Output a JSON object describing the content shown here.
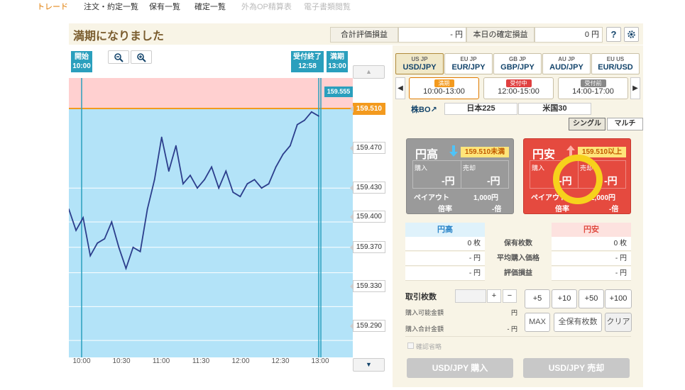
{
  "nav": {
    "items": [
      {
        "label": "トレード",
        "state": "active"
      },
      {
        "label": "注文・約定一覧",
        "state": "normal"
      },
      {
        "label": "保有一覧",
        "state": "normal"
      },
      {
        "label": "確定一覧",
        "state": "normal"
      },
      {
        "label": "外為OP精算表",
        "state": "disabled"
      },
      {
        "label": "電子書類閲覧",
        "state": "disabled"
      }
    ]
  },
  "status": {
    "title": "満期になりました"
  },
  "summary": {
    "valuation_label": "合計評価損益",
    "valuation_value": "- 円",
    "realized_label": "本日の確定損益",
    "realized_value": "0 円",
    "help_label": "?",
    "settings_icon": "gear-icon"
  },
  "chart": {
    "start_marker": {
      "label": "開始",
      "time": "10:00"
    },
    "close_marker": {
      "label": "受付終了",
      "time": "12:58"
    },
    "expiry_marker": {
      "label": "満期",
      "time": "13:00"
    },
    "current_price": "159.555",
    "target_price": "159.510",
    "price_labels": [
      "159.470",
      "159.430",
      "159.400",
      "159.370",
      "159.330",
      "159.290"
    ],
    "time_labels": [
      "10:00",
      "10:30",
      "11:00",
      "11:30",
      "12:00",
      "12:30",
      "13:00"
    ],
    "zoom_out_icon": "zoom-out-icon",
    "zoom_in_icon": "zoom-in-icon",
    "colors": {
      "upper_zone": "#ffd0d0",
      "lower_zone": "#b3e3f8",
      "line": "#2c3e8c",
      "target": "#f39a1e",
      "marker": "#2a9fbd"
    }
  },
  "chart_data": {
    "type": "line",
    "x": [
      "10:00",
      "10:05",
      "10:10",
      "10:15",
      "10:20",
      "10:25",
      "10:30",
      "10:35",
      "10:40",
      "10:45",
      "10:50",
      "10:55",
      "11:00",
      "11:05",
      "11:10",
      "11:15",
      "11:20",
      "11:25",
      "11:30",
      "11:35",
      "11:40",
      "11:45",
      "11:50",
      "11:55",
      "12:00",
      "12:05",
      "12:10",
      "12:15",
      "12:20",
      "12:25",
      "12:30",
      "12:35",
      "12:40",
      "12:45",
      "12:50",
      "12:55"
    ],
    "series": [
      {
        "values": [
          159.445,
          159.42,
          159.435,
          159.39,
          159.405,
          159.41,
          159.43,
          159.4,
          159.375,
          159.4,
          159.395,
          159.445,
          159.48,
          159.53,
          159.49,
          159.52,
          159.475,
          159.485,
          159.47,
          159.48,
          159.495,
          159.47,
          159.49,
          159.465,
          159.46,
          159.475,
          159.48,
          159.47,
          159.475,
          159.495,
          159.51,
          159.52,
          159.545,
          159.55,
          159.56,
          159.555
        ]
      }
    ],
    "xlabel": "",
    "ylabel": "",
    "ylim": [
      159.27,
      159.6
    ],
    "title": ""
  },
  "pairs": {
    "tabs": [
      {
        "label": "USD/JPY",
        "flags": "US JP",
        "selected": true
      },
      {
        "label": "EUR/JPY",
        "flags": "EU JP",
        "selected": false
      },
      {
        "label": "GBP/JPY",
        "flags": "GB JP",
        "selected": false
      },
      {
        "label": "AUD/JPY",
        "flags": "AU JP",
        "selected": false
      },
      {
        "label": "EUR/USD",
        "flags": "EU US",
        "selected": false
      }
    ]
  },
  "rounds": {
    "prev_icon": "chevron-left-icon",
    "next_icon": "chevron-right-icon",
    "items": [
      {
        "badge": "満期",
        "time": "10:00-13:00",
        "badge_color": "#f39a1e",
        "selected": true
      },
      {
        "badge": "受付中",
        "time": "12:00-15:00",
        "badge_color": "#e04040",
        "selected": false
      },
      {
        "badge": "受付前",
        "time": "14:00-17:00",
        "badge_color": "#888888",
        "selected": false
      }
    ]
  },
  "products": {
    "label": "株BO↗",
    "items": [
      "日本225",
      "米国30"
    ]
  },
  "modes": {
    "single": "シングル",
    "multi": "マルチ"
  },
  "options": {
    "high": {
      "title": "円高",
      "icon": "arrow-down-icon",
      "badge": "159.510未満",
      "buy_label": "購入",
      "sell_label": "売却",
      "buy_value": "-円",
      "sell_value": "-円",
      "payout_label": "ペイアウト",
      "payout_value": "1,000円",
      "rate_label": "倍率",
      "rate_value": "-倍",
      "color": "#9a9a9a"
    },
    "low": {
      "title": "円安",
      "icon": "arrow-up-icon",
      "badge": "159.510以上",
      "buy_label": "購入",
      "sell_label": "売却",
      "buy_value": "-円",
      "sell_value": "-円",
      "payout_label": "ペイアウト",
      "payout_value": "1,000円",
      "rate_label": "倍率",
      "rate_value": "-倍",
      "color": "#e54a3f"
    }
  },
  "positions": {
    "high_header": "円高",
    "low_header": "円安",
    "rows": [
      {
        "label": "保有枚数",
        "high": "0 枚",
        "low": "0 枚"
      },
      {
        "label": "平均購入価格",
        "high": "- 円",
        "low": "- 円"
      },
      {
        "label": "評価損益",
        "high": "- 円",
        "low": "- 円"
      }
    ]
  },
  "order": {
    "qty_label": "取引枚数",
    "qty_value": "",
    "plus": "+",
    "minus": "−",
    "available_label": "購入可能金額",
    "available_value": "円",
    "total_label": "購入合計金額",
    "total_value": "- 円",
    "add_buttons": [
      "+5",
      "+10",
      "+50",
      "+100"
    ],
    "max_label": "MAX",
    "all_label": "全保有枚数",
    "clear_label": "クリア",
    "confirm_label": "確認省略",
    "buy_button": "USD/JPY 購入",
    "sell_button": "USD/JPY 売却"
  }
}
